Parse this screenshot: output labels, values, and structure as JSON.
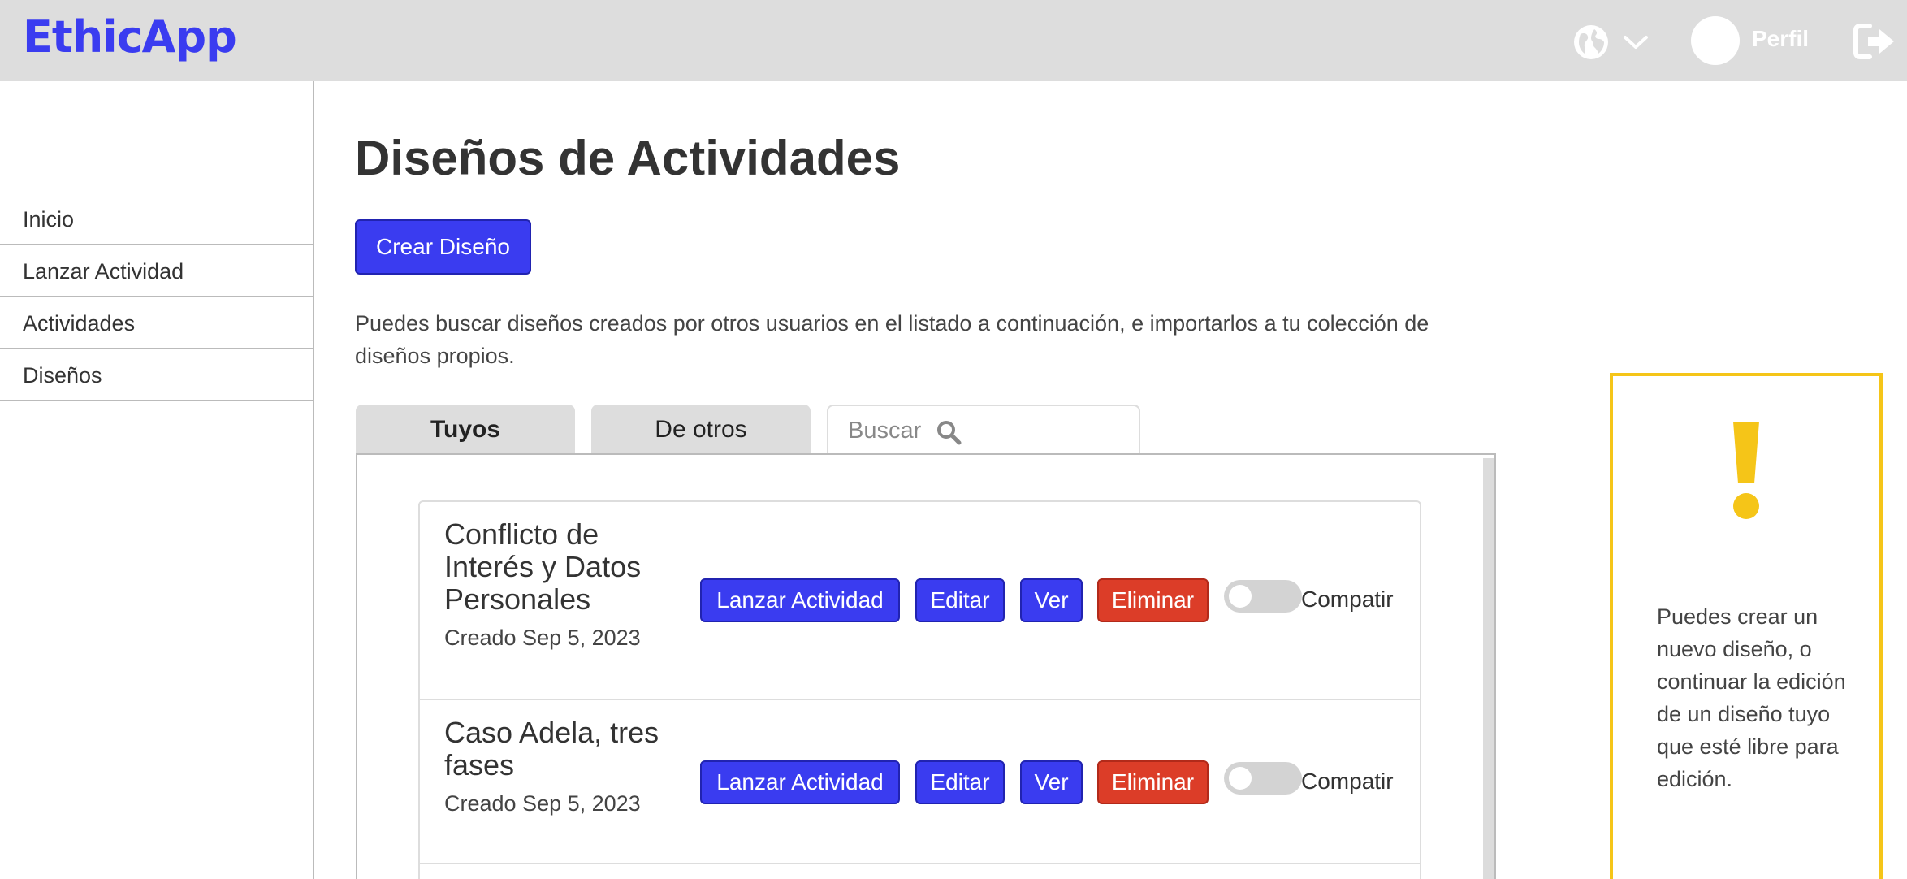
{
  "header": {
    "logo": "EthicApp",
    "globe_icon": "globe-icon",
    "language_chevron_icon": "chevron-down-icon",
    "profile_label": "Perfil",
    "logout_icon": "logout-icon"
  },
  "sidebar": {
    "items": [
      {
        "label": "Inicio"
      },
      {
        "label": "Lanzar Actividad"
      },
      {
        "label": "Actividades"
      },
      {
        "label": "Diseños"
      }
    ]
  },
  "main": {
    "title": "Diseños de Actividades",
    "create_button": "Crear Diseño",
    "intro": "Puedes buscar diseños creados por otros usuarios en el listado a continuación, e importarlos a tu colección de diseños propios.",
    "tabs": [
      {
        "label": "Tuyos",
        "active": true
      },
      {
        "label": "De otros",
        "active": false
      }
    ],
    "search": {
      "placeholder": "Buscar",
      "icon": "search-icon"
    },
    "designs": [
      {
        "title": "Conflicto de Interés y Datos Personales",
        "created": "Creado Sep 5, 2023",
        "launch_label": "Lanzar Actividad",
        "edit_label": "Editar",
        "view_label": "Ver",
        "delete_label": "Eliminar",
        "share_label": "Compatir",
        "shared": false
      },
      {
        "title": "Caso Adela, tres fases",
        "created": "Creado Sep 5, 2023",
        "launch_label": "Lanzar Actividad",
        "edit_label": "Editar",
        "view_label": "Ver",
        "delete_label": "Eliminar",
        "share_label": "Compatir",
        "shared": false
      }
    ]
  },
  "info_panel": {
    "icon": "exclamation-icon",
    "text": "Puedes crear un nuevo diseño, o continuar la edición de un diseño tuyo que esté libre para edición."
  },
  "colors": {
    "brand": "#3a3cf0",
    "danger": "#dc3d28",
    "warning": "#f5c518",
    "header_bg": "#dddddd"
  }
}
